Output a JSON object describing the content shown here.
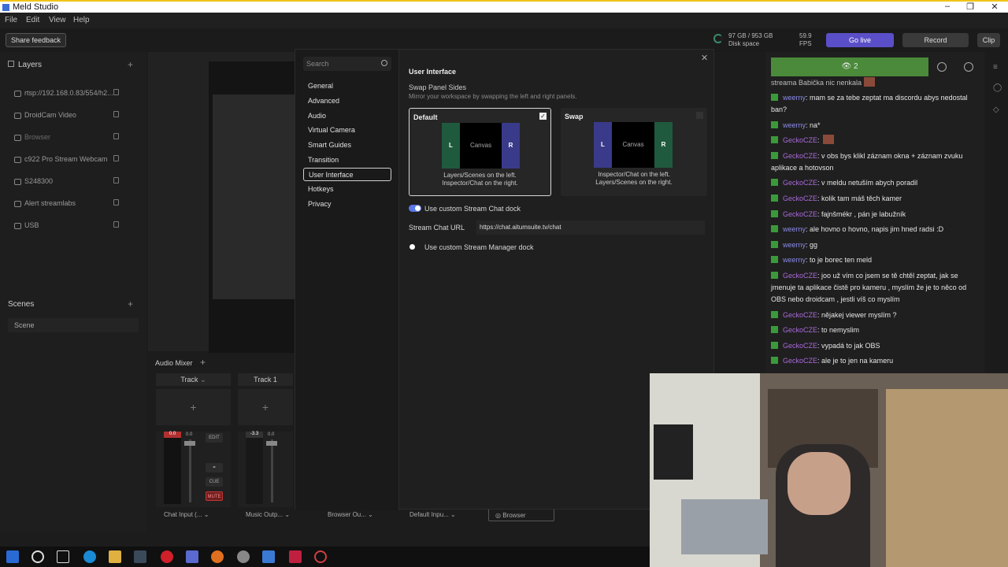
{
  "window": {
    "title": "Meld Studio"
  },
  "menu": [
    "File",
    "Edit",
    "View",
    "Help"
  ],
  "toolbar": {
    "feedback": "Share feedback",
    "disk_value": "97 GB / 953 GB",
    "disk_label": "Disk space",
    "fps_value": "59.9",
    "fps_label": "FPS",
    "go_live": "Go live",
    "record": "Record",
    "clip": "Clip"
  },
  "layers": {
    "title": "Layers",
    "items": [
      "rtsp://192.168.0.83/554/h2...",
      "DroidCam Video",
      "Browser",
      "c922 Pro Stream Webcam",
      "S248300",
      "Alert streamlabs",
      "USB"
    ]
  },
  "scenes": {
    "title": "Scenes",
    "items": [
      "Scene"
    ]
  },
  "mixer": {
    "title": "Audio Mixer",
    "tracks": [
      "Track",
      "Track 1"
    ],
    "ch1": {
      "peak": "0.0",
      "level": "0.0",
      "edit": "EDIT",
      "cue": "CUE",
      "mute": "MUTE"
    },
    "ch2": {
      "peak": "-3.3",
      "level": "0.0"
    },
    "outputs": [
      "Chat Input (...",
      "Music Outp...",
      "Browser Ou...",
      "Default Inpu...",
      "Browser"
    ]
  },
  "settings": {
    "search_placeholder": "Search",
    "nav": [
      "General",
      "Advanced",
      "Audio",
      "Virtual Camera",
      "Smart Guides",
      "Transition",
      "User Interface",
      "Hotkeys",
      "Privacy"
    ],
    "section": "User Interface",
    "swap_title": "Swap Panel Sides",
    "swap_desc": "Mirror your workspace by swapping the left and right panels.",
    "card_default": {
      "label": "Default",
      "L": "L",
      "canvas": "Canvas",
      "R": "R",
      "cap1": "Layers/Scenes on the left.",
      "cap2": "Inspector/Chat on the right."
    },
    "card_swap": {
      "label": "Swap",
      "L": "L",
      "canvas": "Canvas",
      "R": "R",
      "cap1": "Inspector/Chat on the left.",
      "cap2": "Layers/Scenes on the right."
    },
    "custom_chat": "Use custom Stream Chat dock",
    "chat_url_label": "Stream Chat URL",
    "chat_url": "https://chat.aitumsuite.tv/chat",
    "custom_manager": "Use custom Stream Manager dock",
    "accent": "#5a78e6"
  },
  "chat": {
    "viewers": "2",
    "top_line": "streama Babička nic nenkala",
    "messages": [
      {
        "user": "weerny",
        "text": ": mam se za tebe zeptat ma discordu abys nedostal ban?",
        "c": "u1"
      },
      {
        "user": "weerny",
        "text": ": na*",
        "c": "u1"
      },
      {
        "user": "GeckoCZE",
        "text": ":",
        "c": "u2"
      },
      {
        "user": "GeckoCZE",
        "text": ": v obs bys klikl záznam okna + záznam zvuku aplikace a hotovson",
        "c": "u2"
      },
      {
        "user": "GeckoCZE",
        "text": ": v meldu netuším abych poradil",
        "c": "u2"
      },
      {
        "user": "GeckoCZE",
        "text": ": kolik tam máš těch kamer",
        "c": "u2"
      },
      {
        "user": "GeckoCZE",
        "text": ": fajnšmékr , pán je labužník",
        "c": "u2"
      },
      {
        "user": "weerny",
        "text": ": ale hovno o hovno, napis jim hned radsi :D",
        "c": "u1"
      },
      {
        "user": "weerny",
        "text": ": gg",
        "c": "u1"
      },
      {
        "user": "weerny",
        "text": ": to je borec ten meld",
        "c": "u1"
      },
      {
        "user": "GeckoCZE",
        "text": ": joo už vím co jsem se tě chtěl zeptat, jak se jmenuje ta aplikace čistě pro kameru , myslím že je to něco od OBS nebo droidcam , jestli víš co myslím",
        "c": "u2"
      },
      {
        "user": "GeckoCZE",
        "text": ": nějakej viewer myslím ?",
        "c": "u2"
      },
      {
        "user": "GeckoCZE",
        "text": ": to nemyslim",
        "c": "u2"
      },
      {
        "user": "GeckoCZE",
        "text": ": vypadá to jak OBS",
        "c": "u2"
      },
      {
        "user": "GeckoCZE",
        "text": ": ale je to jen na kameru",
        "c": "u2"
      }
    ]
  }
}
